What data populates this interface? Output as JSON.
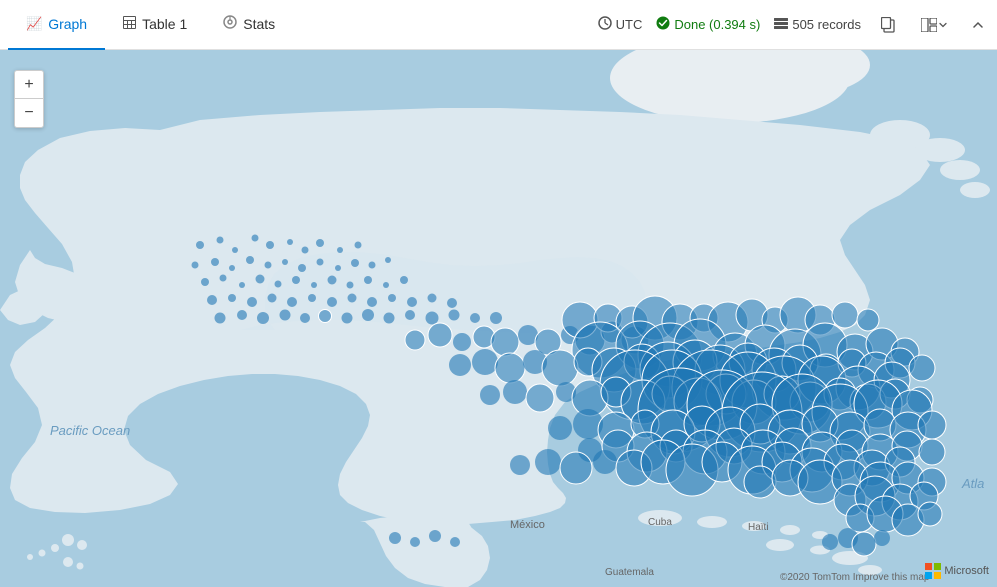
{
  "toolbar": {
    "tabs": [
      {
        "id": "graph",
        "label": "Graph",
        "icon": "📈",
        "active": true
      },
      {
        "id": "table",
        "label": "Table 1",
        "icon": "⊞",
        "active": false
      },
      {
        "id": "stats",
        "label": "Stats",
        "icon": "◎",
        "active": false
      }
    ],
    "timezone": "UTC",
    "status": "Done (0.394 s)",
    "records": "505 records",
    "timezone_icon": "🕐",
    "status_icon": "✓",
    "records_icon": "🔢"
  },
  "map": {
    "zoom_in": "+",
    "zoom_out": "−",
    "pacific_label": "Pacific Ocean",
    "atlantic_label": "Atla",
    "attribution": "©2020 TomTom  Improve this map",
    "microsoft": "Microsoft"
  }
}
